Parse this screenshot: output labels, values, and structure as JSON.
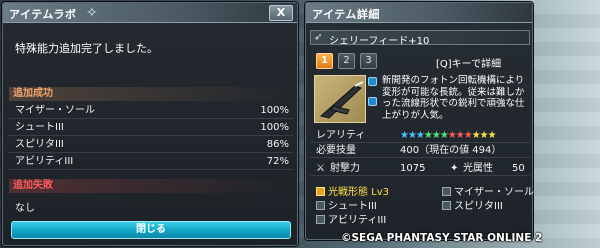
{
  "lab": {
    "title": "アイテムラボ",
    "close_x": "X",
    "message": "特殊能力追加完了しました。",
    "success_header": "追加成功",
    "success_rows": [
      {
        "name": "マイザー・ソール",
        "pct": "100%"
      },
      {
        "name": "シュートIII",
        "pct": "100%"
      },
      {
        "name": "スピリタIII",
        "pct": "86%"
      },
      {
        "name": "アビリティIII",
        "pct": "72%"
      }
    ],
    "fail_header": "追加失敗",
    "fail_value": "なし",
    "close_button": "閉じる"
  },
  "detail": {
    "title": "アイテム詳細",
    "item_name": "シェリーフィード+10",
    "tabs": [
      "1",
      "2",
      "3"
    ],
    "hint": "[Q]キーで詳細",
    "description": "新開発のフォトン回転機構により変形が可能な長銃。従来は難しかった流線形状での鋭利で頑強な仕上がりが人気。",
    "rarity_label": "レアリティ",
    "rarity_stars": 12,
    "required_label": "必要技量",
    "required_value": "400（現在の値 494）",
    "shooting_label": "射撃力",
    "shooting_value": "1075",
    "element_label": "光属性",
    "element_value": "50",
    "abilities": [
      {
        "name": "光戦形態 Lv3",
        "highlight": true
      },
      {
        "name": "マイザー・ソール",
        "highlight": false
      },
      {
        "name": "シュートIII",
        "highlight": false
      },
      {
        "name": "スピリタIII",
        "highlight": false
      },
      {
        "name": "アビリティIII",
        "highlight": false
      }
    ]
  },
  "copyright": "©SEGA PHANTASY STAR ONLINE 2",
  "colors": {
    "accent_cyan": "#14a7c9",
    "success_orange": "#f1a36a",
    "fail_red": "#ff5a5a",
    "tab_active": "#e07a12"
  }
}
